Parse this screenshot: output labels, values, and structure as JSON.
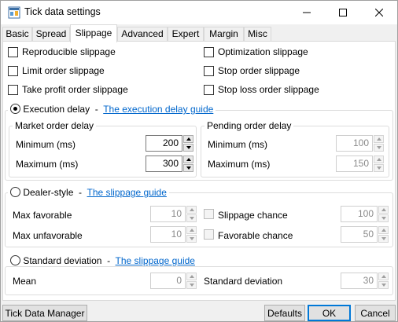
{
  "window": {
    "title": "Tick data settings"
  },
  "tabs": [
    {
      "label": "Basic"
    },
    {
      "label": "Spread"
    },
    {
      "label": "Slippage"
    },
    {
      "label": "Advanced"
    },
    {
      "label": "Expert"
    },
    {
      "label": "Margin"
    },
    {
      "label": "Misc"
    }
  ],
  "active_tab": "Slippage",
  "options": {
    "reproducible": "Reproducible slippage",
    "optimization": "Optimization slippage",
    "limit_order": "Limit order slippage",
    "stop_order": "Stop order slippage",
    "take_profit": "Take profit order slippage",
    "stop_loss": "Stop loss order slippage"
  },
  "execution_delay": {
    "label": "Execution delay",
    "separator": "-",
    "guide_link": "The execution delay guide",
    "market": {
      "title": "Market order delay",
      "min_label": "Minimum (ms)",
      "min_value": "200",
      "max_label": "Maximum (ms)",
      "max_value": "300"
    },
    "pending": {
      "title": "Pending order delay",
      "min_label": "Minimum (ms)",
      "min_value": "100",
      "max_label": "Maximum (ms)",
      "max_value": "150"
    }
  },
  "dealer_style": {
    "label": "Dealer-style",
    "separator": "-",
    "guide_link": "The slippage guide",
    "max_favorable_label": "Max favorable",
    "max_favorable_value": "10",
    "max_unfavorable_label": "Max unfavorable",
    "max_unfavorable_value": "10",
    "slippage_chance_label": "Slippage chance",
    "slippage_chance_value": "100",
    "favorable_chance_label": "Favorable chance",
    "favorable_chance_value": "50"
  },
  "standard_deviation": {
    "label": "Standard deviation",
    "separator": "-",
    "guide_link": "The slippage guide",
    "mean_label": "Mean",
    "mean_value": "0",
    "stddev_label": "Standard deviation",
    "stddev_value": "30"
  },
  "footer": {
    "tick_data_manager": "Tick Data Manager",
    "defaults": "Defaults",
    "ok": "OK",
    "cancel": "Cancel"
  },
  "colors": {
    "link": "#0066cc",
    "focus_border": "#0078d7"
  }
}
